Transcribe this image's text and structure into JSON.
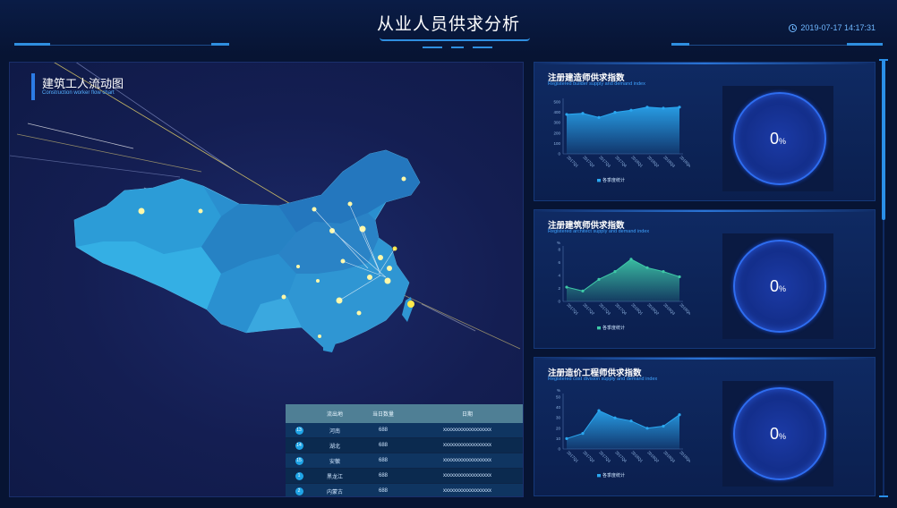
{
  "header": {
    "title": "从业人员供求分析",
    "datetime": "2019-07-17 14:17:31"
  },
  "map": {
    "title": "建筑工人流动图",
    "subtitle": "Construction worker flow chart",
    "table": {
      "headers": [
        "流出地",
        "当日数量",
        "日期"
      ],
      "rows": [
        {
          "rank": "13",
          "place": "河南",
          "count": "688",
          "date": "xxxxxxxxxxxxxxxxxx"
        },
        {
          "rank": "14",
          "place": "湖北",
          "count": "688",
          "date": "xxxxxxxxxxxxxxxxxx"
        },
        {
          "rank": "15",
          "place": "安徽",
          "count": "688",
          "date": "xxxxxxxxxxxxxxxxxx"
        },
        {
          "rank": "1",
          "place": "黑龙江",
          "count": "688",
          "date": "xxxxxxxxxxxxxxxxxx"
        },
        {
          "rank": "2",
          "place": "内蒙古",
          "count": "688",
          "date": "xxxxxxxxxxxxxxxxxx"
        }
      ]
    }
  },
  "panels": [
    {
      "title": "注册建造师供求指数",
      "subtitle": "Registered builder supply and demand index",
      "legend": "各季度统计",
      "gauge": "0",
      "gauge_unit": "%",
      "color": "#2aa7f0",
      "chart_data": {
        "type": "area",
        "x": [
          "2017Q1",
          "2017Q2",
          "2017Q3",
          "2017Q4",
          "2018Q1",
          "2018Q2",
          "2018Q3",
          "2018Q4"
        ],
        "y_ticks": [
          "0",
          "100",
          "200",
          "300",
          "400",
          "500"
        ],
        "ylim": [
          0,
          500
        ],
        "series": [
          {
            "name": "各季度统计",
            "values": [
              380,
              390,
              350,
              400,
              420,
              450,
              440,
              450
            ]
          }
        ]
      }
    },
    {
      "title": "注册建筑师供求指数",
      "subtitle": "Registered architect supply and demand index",
      "legend": "各季度统计",
      "gauge": "0",
      "gauge_unit": "%",
      "color": "#3ec9a7",
      "chart_data": {
        "type": "area",
        "x": [
          "2017Q1",
          "2017Q2",
          "2017Q3",
          "2017Q4",
          "2018Q1",
          "2018Q2",
          "2018Q3",
          "2018Q4"
        ],
        "y_ticks": [
          "0",
          "2",
          "4",
          "6",
          "8"
        ],
        "y_unit": "%",
        "ylim": [
          0,
          8
        ],
        "series": [
          {
            "name": "各季度统计",
            "values": [
              2.2,
              1.6,
              3.4,
              4.6,
              6.5,
              5.2,
              4.6,
              3.8
            ]
          }
        ]
      }
    },
    {
      "title": "注册造价工程师供求指数",
      "subtitle": "Registered cost division supply and demand index",
      "legend": "各季度统计",
      "gauge": "0",
      "gauge_unit": "%",
      "color": "#2aa7f0",
      "chart_data": {
        "type": "area",
        "x": [
          "2017Q1",
          "2017Q2",
          "2017Q3",
          "2017Q4",
          "2018Q1",
          "2018Q2",
          "2018Q3",
          "2018Q4"
        ],
        "y_ticks": [
          "0",
          "10",
          "20",
          "30",
          "40",
          "50"
        ],
        "y_unit": "%",
        "ylim": [
          0,
          50
        ],
        "series": [
          {
            "name": "各季度统计",
            "values": [
              10,
              15,
              37,
              30,
              27,
              20,
              22,
              33
            ]
          }
        ]
      }
    }
  ]
}
